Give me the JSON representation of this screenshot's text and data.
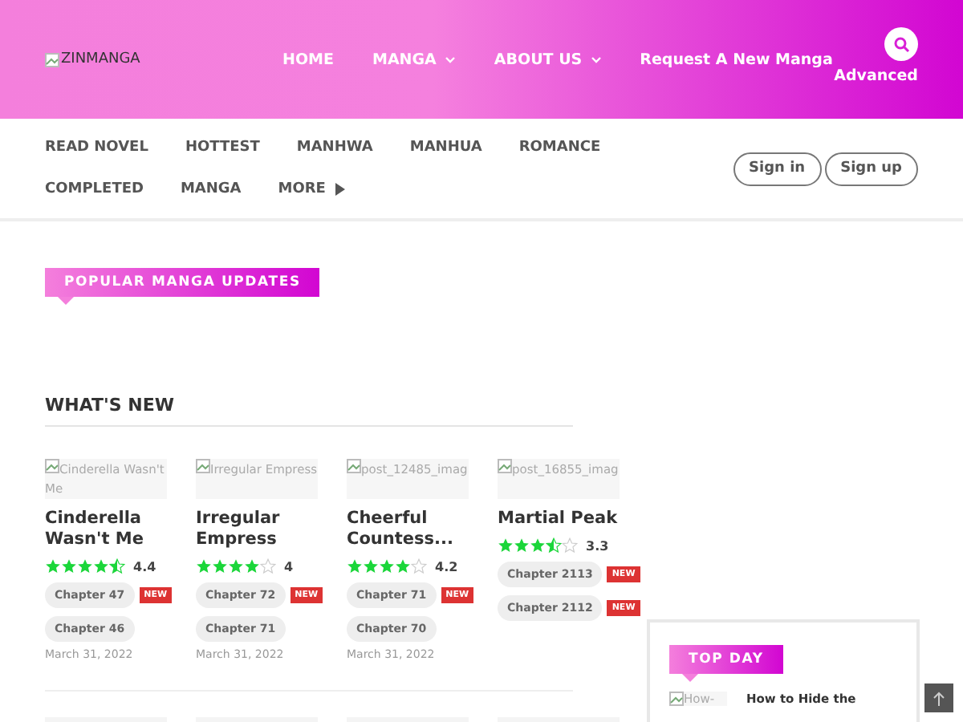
{
  "header": {
    "logo_alt": "ZINMANGA",
    "menu": [
      {
        "label": "HOME",
        "dropdown": false
      },
      {
        "label": "MANGA",
        "dropdown": true
      },
      {
        "label": "ABOUT US",
        "dropdown": true
      },
      {
        "label": "Request A New Manga",
        "dropdown": false
      }
    ],
    "search_label": "Advanced"
  },
  "subnav": {
    "items": [
      {
        "label": "READ NOVEL",
        "more": false
      },
      {
        "label": "HOTTEST",
        "more": false
      },
      {
        "label": "MANHWA",
        "more": false
      },
      {
        "label": "MANHUA",
        "more": false
      },
      {
        "label": "ROMANCE",
        "more": false
      },
      {
        "label": "COMPLETED",
        "more": false
      },
      {
        "label": "MANGA",
        "more": false
      },
      {
        "label": "MORE",
        "more": true
      }
    ],
    "buttons": [
      "Sign in",
      "Sign up"
    ]
  },
  "popular": {
    "title": "POPULAR MANGA UPDATES"
  },
  "whats_new": {
    "title": "WHAT'S NEW",
    "cards": [
      {
        "image_alt": "Cinderella Wasn't Me",
        "title": "Cinderella Wasn't Me",
        "stars": 4.5,
        "rating": "4.4",
        "chapters": [
          {
            "label": "Chapter 47",
            "badge": "NEW"
          },
          {
            "label": "Chapter 46"
          }
        ],
        "date": "March 31, 2022"
      },
      {
        "image_alt": "Irregular Empress",
        "title": "Irregular Empress",
        "stars": 4,
        "rating": "4",
        "chapters": [
          {
            "label": "Chapter 72",
            "badge": "NEW"
          },
          {
            "label": "Chapter 71"
          }
        ],
        "date": "March 31, 2022"
      },
      {
        "image_alt": "post_12485_imag",
        "title": "Cheerful Countess...",
        "stars": 4,
        "rating": "4.2",
        "chapters": [
          {
            "label": "Chapter 71",
            "badge": "NEW"
          },
          {
            "label": "Chapter 70"
          }
        ],
        "date": "March 31, 2022"
      },
      {
        "image_alt": "post_16855_imag",
        "title": "Martial Peak",
        "stars": 3.5,
        "rating": "3.3",
        "chapters": [
          {
            "label": "Chapter 2113",
            "badge": "NEW"
          },
          {
            "label": "Chapter 2112",
            "badge": "NEW"
          }
        ]
      }
    ]
  },
  "sidebar": {
    "title": "TOP DAY",
    "items": [
      {
        "image_alt": "How-",
        "title": "How to Hide the"
      }
    ]
  }
}
